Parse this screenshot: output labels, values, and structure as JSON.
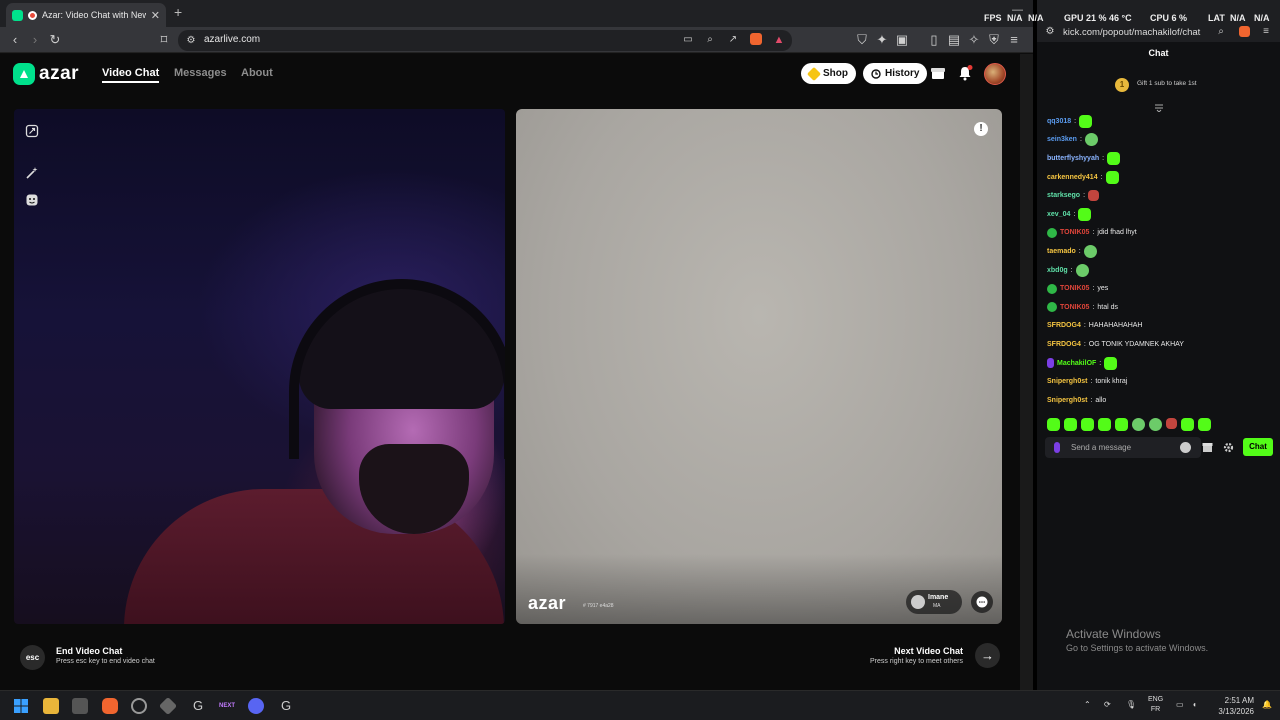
{
  "browser": {
    "tab_title": "Azar: Video Chat with New Pe",
    "url": "azarlive.com"
  },
  "site": {
    "logo": "azar",
    "nav": [
      "Video Chat",
      "Messages",
      "About"
    ],
    "shop": "Shop",
    "history": "History",
    "notification_count": "1"
  },
  "partner": {
    "watermark": "azar",
    "watermark_id": "# 7917 e4a28",
    "name": "Imane",
    "country": "MA"
  },
  "footer": {
    "esc_key": "esc",
    "end_title": "End Video Chat",
    "end_sub": "Press esc key to end video chat",
    "next_title": "Next Video Chat",
    "next_sub": "Press right key to meet others"
  },
  "overlay": {
    "fps_label": "FPS",
    "fps_value": "N/A",
    "fps_value2": "N/A",
    "gpu": "GPU 21 % 46 °C",
    "cpu": "CPU 6 %",
    "lat": "LAT",
    "lat_value": "N/A",
    "lat_value2": "N/A"
  },
  "chat": {
    "url": "kick.com/popout/machakilof/chat",
    "title": "Chat",
    "gift_rank": "1",
    "gift_text": "Gift 1 sub to take 1st",
    "messages": [
      {
        "user": "qq3018",
        "color": "#5b9cf0",
        "text": "",
        "emote": "green",
        "badge": ""
      },
      {
        "user": "sein3ken",
        "color": "#5b9cf0",
        "text": "",
        "emote": "face",
        "badge": ""
      },
      {
        "user": "butterflyshyyah",
        "color": "#8ab4ff",
        "text": "",
        "emote": "green",
        "badge": ""
      },
      {
        "user": "carkennedy414",
        "color": "#f5c542",
        "text": "",
        "emote": "green",
        "badge": ""
      },
      {
        "user": "starksego",
        "color": "#5fe0a8",
        "text": "",
        "emote": "red",
        "badge": ""
      },
      {
        "user": "xev_04",
        "color": "#5fe0a8",
        "text": "",
        "emote": "green",
        "badge": ""
      },
      {
        "user": "TONIK05",
        "color": "#e0453a",
        "text": "jdid fhad lhyt",
        "emote": "",
        "badge": "green"
      },
      {
        "user": "taemado",
        "color": "#f5c542",
        "text": "",
        "emote": "face",
        "badge": ""
      },
      {
        "user": "xbd0g",
        "color": "#5fe0a8",
        "text": "",
        "emote": "face",
        "badge": ""
      },
      {
        "user": "TONIK05",
        "color": "#e0453a",
        "text": "yes",
        "emote": "",
        "badge": "green"
      },
      {
        "user": "TONIK05",
        "color": "#e0453a",
        "text": "htal ds",
        "emote": "",
        "badge": "green"
      },
      {
        "user": "SFRDOG4",
        "color": "#f5c542",
        "text": "HAHAHAHAHAH",
        "emote": "",
        "badge": ""
      },
      {
        "user": "SFRDOG4",
        "color": "#f5c542",
        "text": "OG TONIK YDAMNEK AKHAY",
        "emote": "",
        "badge": ""
      },
      {
        "user": "MachakilOF",
        "color": "#53fc18",
        "text": "",
        "emote": "green",
        "badge": "mic"
      },
      {
        "user": "Snipergh0st",
        "color": "#f5c542",
        "text": "tonik khraj",
        "emote": "",
        "badge": ""
      },
      {
        "user": "Snipergh0st",
        "color": "#f5c542",
        "text": "allo",
        "emote": "",
        "badge": ""
      }
    ],
    "input_placeholder": "Send a message",
    "send_label": "Chat"
  },
  "windows": {
    "activate_title": "Activate Windows",
    "activate_sub": "Go to Settings to activate Windows."
  },
  "taskbar": {
    "next_app": "NEXT",
    "lang1": "ENG",
    "lang2": "FR",
    "time": "2:51 AM",
    "date": "3/13/2026"
  }
}
